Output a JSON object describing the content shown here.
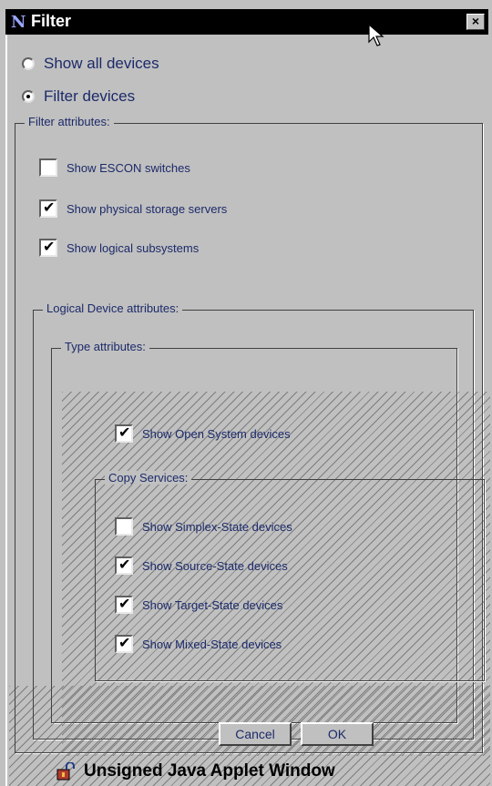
{
  "window": {
    "title": "Filter"
  },
  "radios": [
    {
      "label": "Show all devices",
      "selected": false
    },
    {
      "label": "Filter devices",
      "selected": true
    }
  ],
  "filter_attributes": {
    "legend": "Filter attributes:",
    "items": [
      {
        "label": "Show ESCON switches",
        "checked": false
      },
      {
        "label": "Show physical storage servers",
        "checked": true
      },
      {
        "label": "Show logical subsystems",
        "checked": true
      }
    ]
  },
  "logical_device_attributes": {
    "legend": "Logical Device attributes:",
    "type_attributes": {
      "legend": "Type attributes:",
      "items": [
        {
          "label": "Show Open System devices",
          "checked": true
        }
      ]
    },
    "copy_services": {
      "legend": "Copy Services:",
      "items": [
        {
          "label": "Show Simplex-State devices",
          "checked": false
        },
        {
          "label": "Show Source-State devices",
          "checked": true
        },
        {
          "label": "Show Target-State devices",
          "checked": true
        },
        {
          "label": "Show Mixed-State devices",
          "checked": true
        }
      ]
    }
  },
  "buttons": {
    "cancel": "Cancel",
    "ok": "OK"
  },
  "status_bar": {
    "text": "Unsigned Java Applet Window"
  }
}
